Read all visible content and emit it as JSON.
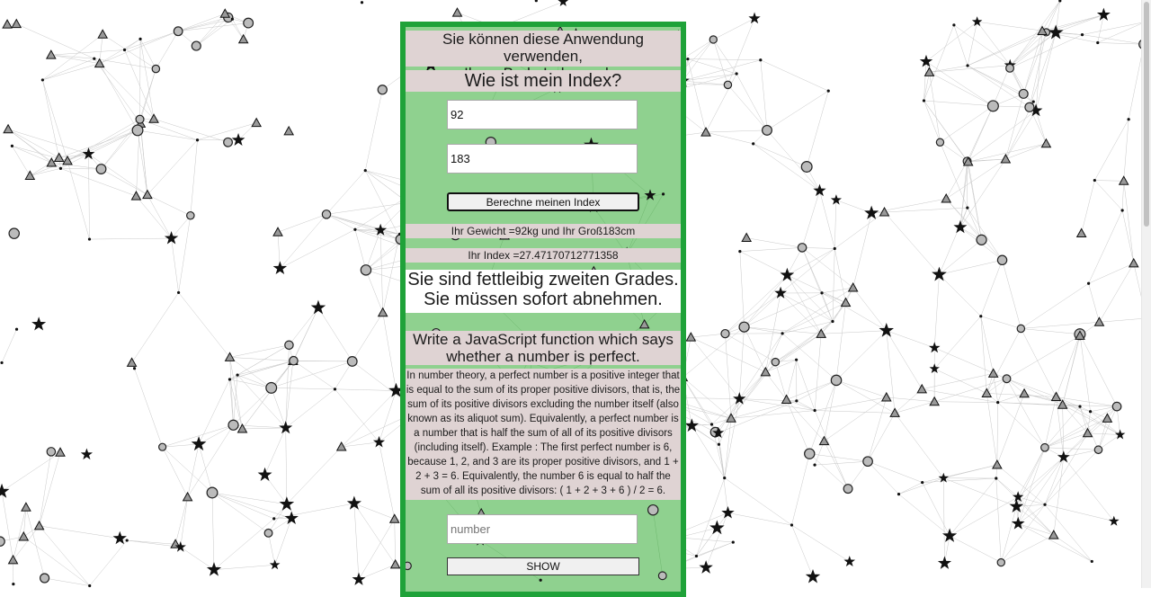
{
  "page": {
    "background": "#ffffff",
    "panel_background": "#8fd18f",
    "panel_border": "#1fa239",
    "band_background": "#dfd3d3"
  },
  "header": {
    "title_line1": "Sie können diese Anwendung verwenden,",
    "title_line2": "um Ihren Body-Index zu lernen",
    "subtitle": "Wie ist mein Index?"
  },
  "form": {
    "weight_value": "92",
    "height_value": "183",
    "calculate_label": "Berechne meinen Index"
  },
  "result": {
    "summary": "Ihr Gewicht =92kg und Ihr Groß183cm",
    "index": "Ihr Index =27.47170712771358",
    "verdict_line1": "Sie sind fettleibig zweiten Grades.",
    "verdict_line2": "Sie müssen sofort abnehmen."
  },
  "task": {
    "title_line1": "Write a JavaScript function which says",
    "title_line2": "whether a number is perfect.",
    "description": "In number theory, a perfect number is a positive integer that is equal to the sum of its proper positive divisors, that is, the sum of its positive divisors excluding the number itself (also known as its aliquot sum). Equivalently, a perfect number is a number that is half the sum of all of its positive divisors (including itself). Example : The first perfect number is 6, because 1, 2, and 3 are its proper positive divisors, and 1 + 2 + 3 = 6. Equivalently, the number 6 is equal to half the sum of all its positive divisors: ( 1 + 2 + 3 + 6 ) / 2 = 6.",
    "number_placeholder": "number",
    "show_label": "SHOW"
  }
}
